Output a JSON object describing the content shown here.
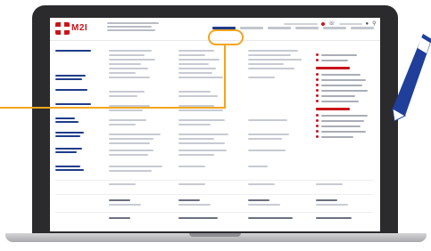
{
  "site": {
    "brand": "M2I"
  },
  "header": {
    "nav_items": [
      "",
      "",
      "",
      "",
      "",
      "",
      ""
    ],
    "active_index": 2
  },
  "colors": {
    "brand_red": "#c9141b",
    "navy": "#1f3c8a",
    "highlight_orange": "#f4a51c",
    "laptop_bezel": "#2b2b2d",
    "pen_blue": "#1f3f9a"
  },
  "icons": {
    "cart": "cart-icon",
    "phone": "phone-icon",
    "user": "user-icon",
    "search": "search-icon"
  }
}
